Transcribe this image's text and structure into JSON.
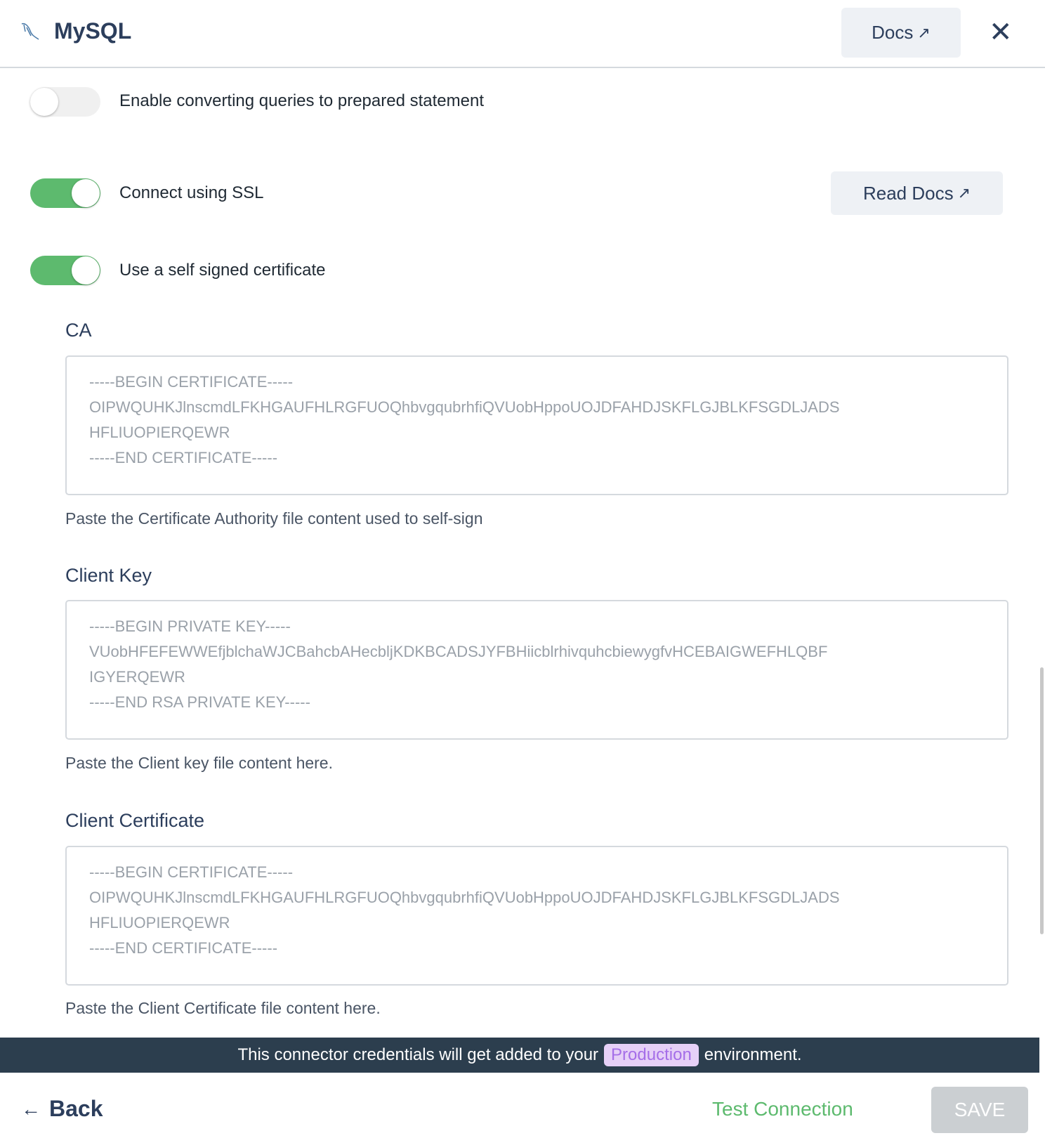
{
  "header": {
    "title": "MySQL",
    "docs_label": "Docs",
    "logo": "mysql-dolphin-logo"
  },
  "toggles": [
    {
      "label": "Enable converting queries to prepared statement",
      "on": false
    },
    {
      "label": "Connect using SSL",
      "on": true
    },
    {
      "label": "Use a self signed certificate",
      "on": true
    }
  ],
  "read_docs_label": "Read Docs",
  "fields": [
    {
      "label": "CA",
      "value": "-----BEGIN CERTIFICATE-----\nOIPWQUHKJlnscmdLFKHGAUFHLRGFUOQhbvgqubrhfiQVUobHppoUOJDFAHDJSKFLGJBLKFSGDLJADS\nHFLIUOPIERQEWR\n-----END CERTIFICATE-----",
      "help": "Paste the Certificate Authority file content used to self-sign"
    },
    {
      "label": "Client Key",
      "value": "-----BEGIN PRIVATE KEY-----\nVUobHFEFEWWEfjblchaWJCBahcbAHecbljKDKBCADSJYFBHiicblrhivquhcbiewygfvHCEBAIGWEFHLQBF\nIGYERQEWR\n-----END RSA PRIVATE KEY-----",
      "help": "Paste the Client key file content here."
    },
    {
      "label": "Client Certificate",
      "value": "-----BEGIN CERTIFICATE-----\nOIPWQUHKJlnscmdLFKHGAUFHLRGFUOQhbvgqubrhfiQVUobHppoUOJDFAHDJSKFLGJBLKFSGDLJADS\nHFLIUOPIERQEWR\n-----END CERTIFICATE-----",
      "help": "Paste the Client Certificate file content here."
    }
  ],
  "banner": {
    "prefix": "This connector credentials will get added to your",
    "env": "Production",
    "suffix": "environment."
  },
  "footer": {
    "back_label": "Back",
    "test_label": "Test Connection",
    "save_label": "SAVE"
  },
  "colors": {
    "toggle_on": "#5dba6e",
    "test": "#5dba6e",
    "save_disabled": "#cbcfd2",
    "banner": "#2c3e4e",
    "badge_text": "#a56ee8"
  }
}
